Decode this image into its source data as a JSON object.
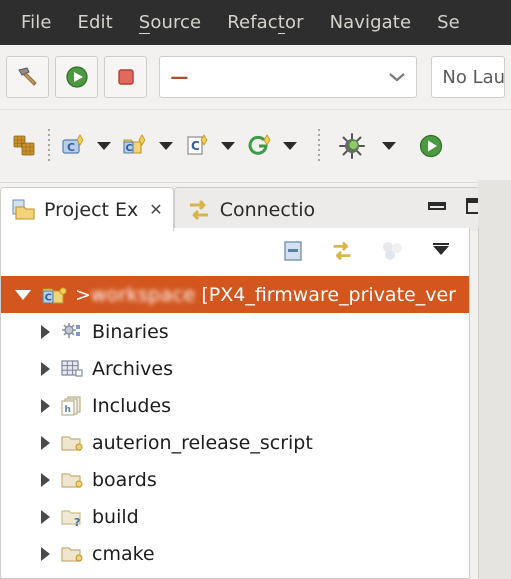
{
  "menubar": {
    "items": [
      {
        "label": "File",
        "accel_index": -1
      },
      {
        "label": "Edit",
        "accel_index": -1
      },
      {
        "label": "Source",
        "accel_index": 0
      },
      {
        "label": "Refactor",
        "accel_index": 5
      },
      {
        "label": "Navigate",
        "accel_index": -1
      },
      {
        "label": "Se",
        "accel_index": -1
      }
    ]
  },
  "toolbar_main": {
    "build_button": "build-hammer",
    "run_button": "run-play",
    "stop_button": "stop-square",
    "launch_config_value": "—",
    "launch_config_placeholder": "",
    "launch_mode_label": "No Lau"
  },
  "toolbar_secondary": {
    "new_project_icon": "new-c-project-icon",
    "items": [
      {
        "icon": "new-c-class-icon",
        "has_dropdown": true
      },
      {
        "icon": "new-c-folder-icon",
        "has_dropdown": true
      },
      {
        "icon": "new-c-file-icon",
        "has_dropdown": true
      },
      {
        "icon": "git-icon",
        "has_dropdown": true
      },
      {
        "icon": "debug-bug-icon",
        "has_dropdown": true
      },
      {
        "icon": "run-icon",
        "has_dropdown": true
      }
    ],
    "highlight": {
      "color": "#e8421a",
      "target": "debug-bug-icon"
    }
  },
  "tabs": [
    {
      "label": "Project Ex",
      "icon": "project-explorer-icon",
      "active": true,
      "closeable": true,
      "close_glyph": "✕"
    },
    {
      "label": "Connectio",
      "icon": "connections-icon",
      "active": false,
      "closeable": false
    }
  ],
  "window_controls": {
    "minimize": "minimize-icon",
    "maximize": "maximize-icon"
  },
  "view_toolbar": {
    "items": [
      {
        "icon": "collapse-all-icon"
      },
      {
        "icon": "link-with-editor-icon"
      },
      {
        "icon": "filter-icon"
      },
      {
        "icon": "view-menu-chevron-icon"
      }
    ]
  },
  "tree": {
    "root": {
      "prefix": "> ",
      "blurred_name": "workspace",
      "visible_name": "[PX4_firmware_private_ver",
      "icon": "c-project-icon",
      "expanded": true,
      "selected": true,
      "selection_color": "#d4561f"
    },
    "children": [
      {
        "label": "Binaries",
        "icon": "binaries-icon",
        "expanded": false
      },
      {
        "label": "Archives",
        "icon": "archives-icon",
        "expanded": false
      },
      {
        "label": "Includes",
        "icon": "includes-icon",
        "expanded": false
      },
      {
        "label": "auterion_release_script",
        "icon": "folder-icon",
        "expanded": false
      },
      {
        "label": "boards",
        "icon": "folder-icon",
        "expanded": false
      },
      {
        "label": "build",
        "icon": "folder-question-icon",
        "expanded": false
      },
      {
        "label": "cmake",
        "icon": "folder-icon",
        "expanded": false
      }
    ]
  }
}
